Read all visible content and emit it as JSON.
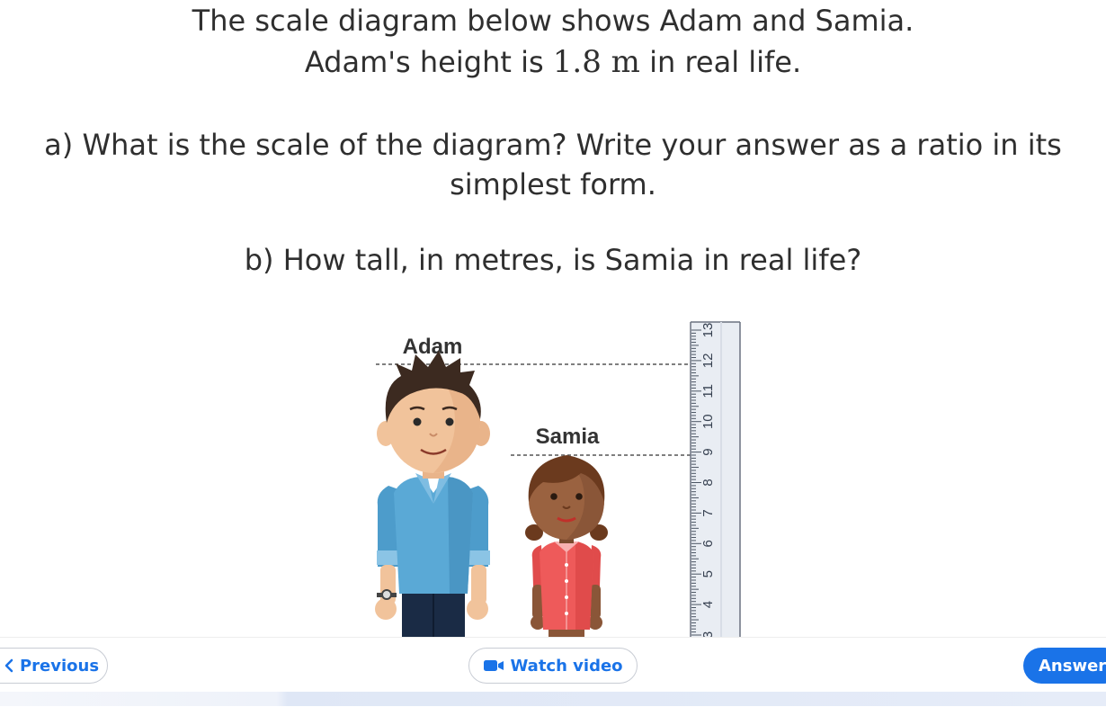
{
  "question": {
    "line1": "The scale diagram below shows Adam and Samia.",
    "line2_prefix": "Adam's height is ",
    "line2_value": "1.8 m",
    "line2_suffix": " in real life.",
    "part_a_line1": "a) What is the scale of the diagram? Write your answer as a ratio in its",
    "part_a_line2": "simplest form.",
    "part_b": "b) How tall, in metres, is Samia in real life?"
  },
  "diagram": {
    "adam_label": "Adam",
    "samia_label": "Samia",
    "ruler_labels": [
      "3",
      "4",
      "5",
      "6",
      "7",
      "8",
      "9",
      "10",
      "11",
      "12",
      "13"
    ],
    "colors": {
      "dashed_line": "#555555",
      "ruler_fill": "#e9edf3",
      "adam_shirt": "#5aa9d6",
      "samia_top": "#ee5a5a"
    }
  },
  "nav": {
    "previous_label": "Previous",
    "watch_video_label": "Watch video",
    "answer_label": "Answer",
    "accent_color": "#1a73e8"
  }
}
